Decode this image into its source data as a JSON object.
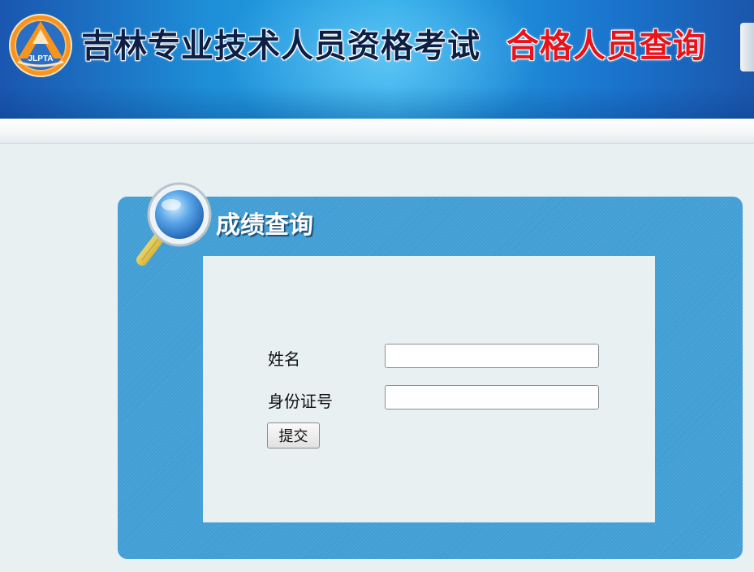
{
  "header": {
    "logo_text": "JLPTA",
    "site_title": "吉林专业技术人员资格考试",
    "page_subtitle": "合格人员查询"
  },
  "query_panel": {
    "title": "成绩查询",
    "name_label": "姓名",
    "name_value": "",
    "id_label": "身份证号",
    "id_value": "",
    "submit_label": "提交"
  },
  "colors": {
    "banner_blue": "#1e8fd8",
    "subtitle_red": "#e8141a",
    "panel_blue": "#3f9dd4",
    "page_bg": "#e8f0f1"
  },
  "icons": {
    "logo": "jlpta-logo-icon",
    "panel": "magnifier-icon"
  }
}
